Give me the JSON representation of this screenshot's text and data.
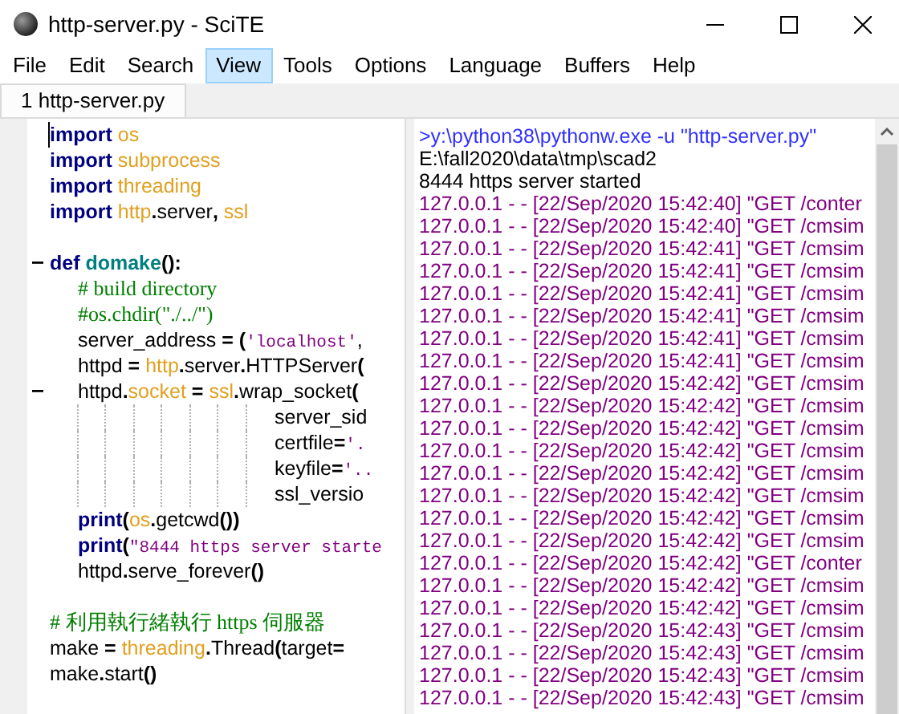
{
  "window": {
    "title": "http-server.py - SciTE"
  },
  "menu": [
    {
      "label": "File",
      "selected": false
    },
    {
      "label": "Edit",
      "selected": false
    },
    {
      "label": "Search",
      "selected": false
    },
    {
      "label": "View",
      "selected": true
    },
    {
      "label": "Tools",
      "selected": false
    },
    {
      "label": "Options",
      "selected": false
    },
    {
      "label": "Language",
      "selected": false
    },
    {
      "label": "Buffers",
      "selected": false
    },
    {
      "label": "Help",
      "selected": false
    }
  ],
  "tabs": [
    {
      "label": "1 http-server.py",
      "selected": true
    }
  ],
  "editor": {
    "lines": [
      {
        "collapsible": false,
        "segments": [
          {
            "kind": "keyword",
            "text": "import"
          },
          {
            "kind": "module",
            "text": " os"
          }
        ]
      },
      {
        "collapsible": false,
        "segments": [
          {
            "kind": "keyword",
            "text": "import"
          },
          {
            "kind": "module",
            "text": " subprocess"
          }
        ]
      },
      {
        "collapsible": false,
        "segments": [
          {
            "kind": "keyword",
            "text": "import"
          },
          {
            "kind": "module",
            "text": " threading"
          }
        ]
      },
      {
        "collapsible": false,
        "segments": [
          {
            "kind": "keyword",
            "text": "import"
          },
          {
            "kind": "module",
            "text": " http"
          },
          {
            "kind": "operator",
            "text": "."
          },
          {
            "kind": "plain",
            "text": "server"
          },
          {
            "kind": "operator",
            "text": ","
          },
          {
            "kind": "module",
            "text": " ssl"
          }
        ]
      },
      {
        "collapsible": false
      },
      {
        "collapsible": true,
        "segments": [
          {
            "kind": "keyword",
            "text": "def"
          },
          {
            "kind": "defname",
            "text": " domake"
          },
          {
            "kind": "operator",
            "text": "():"
          }
        ],
        "children": [
          {
            "collapsible": false,
            "segments": [
              {
                "kind": "comment",
                "text": "# build directory"
              }
            ]
          },
          {
            "collapsible": false,
            "segments": [
              {
                "kind": "comment",
                "text": "#os.chdir(\"./../\")"
              }
            ]
          },
          {
            "collapsible": false,
            "segments": [
              {
                "kind": "plain",
                "text": "server_address "
              },
              {
                "kind": "operator",
                "text": "="
              },
              {
                "kind": "operator",
                "text": " ("
              },
              {
                "kind": "string",
                "text": "'localhost'"
              },
              {
                "kind": "plain",
                "text": ","
              }
            ]
          },
          {
            "collapsible": false,
            "segments": [
              {
                "kind": "plain",
                "text": "httpd "
              },
              {
                "kind": "operator",
                "text": "="
              },
              {
                "kind": "module",
                "text": " http"
              },
              {
                "kind": "operator",
                "text": "."
              },
              {
                "kind": "plain",
                "text": "server"
              },
              {
                "kind": "operator",
                "text": "."
              },
              {
                "kind": "plain",
                "text": "HTTPServer"
              },
              {
                "kind": "operator",
                "text": "("
              }
            ]
          },
          {
            "collapsible": true,
            "segments": [
              {
                "kind": "plain",
                "text": "httpd"
              },
              {
                "kind": "operator",
                "text": "."
              },
              {
                "kind": "module",
                "text": "socket"
              },
              {
                "kind": "operator",
                "text": " ="
              },
              {
                "kind": "module",
                "text": " ssl"
              },
              {
                "kind": "operator",
                "text": "."
              },
              {
                "kind": "plain",
                "text": "wrap_socket"
              },
              {
                "kind": "operator",
                "text": "("
              }
            ],
            "children": [
              {
                "kind": "continuation",
                "collapsible": false,
                "segments": [
                  {
                    "kind": "plain",
                    "text": "server_sid"
                  }
                ]
              },
              {
                "kind": "continuation",
                "collapsible": false,
                "segments": [
                  {
                    "kind": "plain",
                    "text": "certfile"
                  },
                  {
                    "kind": "operator",
                    "text": "="
                  },
                  {
                    "kind": "string",
                    "text": "'."
                  }
                ]
              },
              {
                "kind": "continuation",
                "collapsible": false,
                "segments": [
                  {
                    "kind": "plain",
                    "text": "keyfile"
                  },
                  {
                    "kind": "operator",
                    "text": "="
                  },
                  {
                    "kind": "string",
                    "text": "'.."
                  }
                ]
              },
              {
                "kind": "continuation",
                "collapsible": false,
                "segments": [
                  {
                    "kind": "plain",
                    "text": "ssl_versio"
                  }
                ]
              }
            ]
          },
          {
            "collapsible": false,
            "segments": [
              {
                "kind": "keyword",
                "text": "print"
              },
              {
                "kind": "operator",
                "text": "("
              },
              {
                "kind": "module",
                "text": "os"
              },
              {
                "kind": "operator",
                "text": "."
              },
              {
                "kind": "plain",
                "text": "getcwd"
              },
              {
                "kind": "operator",
                "text": "())"
              }
            ]
          },
          {
            "collapsible": false,
            "segments": [
              {
                "kind": "keyword",
                "text": "print"
              },
              {
                "kind": "operator",
                "text": "("
              },
              {
                "kind": "string",
                "text": "\"8444 https server starte"
              }
            ]
          },
          {
            "collapsible": false,
            "segments": [
              {
                "kind": "plain",
                "text": "httpd"
              },
              {
                "kind": "operator",
                "text": "."
              },
              {
                "kind": "plain",
                "text": "serve_forever"
              },
              {
                "kind": "operator",
                "text": "()"
              }
            ]
          }
        ]
      },
      {
        "collapsible": false
      },
      {
        "collapsible": false,
        "segments": [
          {
            "kind": "comment",
            "text": "# 利用執行緒執行 https 伺服器"
          }
        ]
      },
      {
        "collapsible": false,
        "segments": [
          {
            "kind": "plain",
            "text": "make "
          },
          {
            "kind": "operator",
            "text": "="
          },
          {
            "kind": "module",
            "text": " threading"
          },
          {
            "kind": "operator",
            "text": "."
          },
          {
            "kind": "plain",
            "text": "Thread"
          },
          {
            "kind": "operator",
            "text": "("
          },
          {
            "kind": "plain",
            "text": "target"
          },
          {
            "kind": "operator",
            "text": "="
          }
        ]
      },
      {
        "collapsible": false,
        "segments": [
          {
            "kind": "plain",
            "text": "make"
          },
          {
            "kind": "operator",
            "text": "."
          },
          {
            "kind": "plain",
            "text": "start"
          },
          {
            "kind": "operator",
            "text": "()"
          }
        ]
      }
    ]
  },
  "output": {
    "lines": [
      {
        "kind": "command",
        "text": ">y:\\python38\\pythonw.exe -u \"http-server.py\""
      },
      {
        "kind": "plain",
        "text": "E:\\fall2020\\data\\tmp\\scad2"
      },
      {
        "kind": "plain",
        "text": "8444 https server started"
      },
      {
        "kind": "log",
        "text": "127.0.0.1 - - [22/Sep/2020 15:42:40] \"GET /conter"
      },
      {
        "kind": "log",
        "text": "127.0.0.1 - - [22/Sep/2020 15:42:40] \"GET /cmsim"
      },
      {
        "kind": "log",
        "text": "127.0.0.1 - - [22/Sep/2020 15:42:41] \"GET /cmsim"
      },
      {
        "kind": "log",
        "text": "127.0.0.1 - - [22/Sep/2020 15:42:41] \"GET /cmsim"
      },
      {
        "kind": "log",
        "text": "127.0.0.1 - - [22/Sep/2020 15:42:41] \"GET /cmsim"
      },
      {
        "kind": "log",
        "text": "127.0.0.1 - - [22/Sep/2020 15:42:41] \"GET /cmsim"
      },
      {
        "kind": "log",
        "text": "127.0.0.1 - - [22/Sep/2020 15:42:41] \"GET /cmsim"
      },
      {
        "kind": "log",
        "text": "127.0.0.1 - - [22/Sep/2020 15:42:41] \"GET /cmsim"
      },
      {
        "kind": "log",
        "text": "127.0.0.1 - - [22/Sep/2020 15:42:42] \"GET /cmsim"
      },
      {
        "kind": "log",
        "text": "127.0.0.1 - - [22/Sep/2020 15:42:42] \"GET /cmsim"
      },
      {
        "kind": "log",
        "text": "127.0.0.1 - - [22/Sep/2020 15:42:42] \"GET /cmsim"
      },
      {
        "kind": "log",
        "text": "127.0.0.1 - - [22/Sep/2020 15:42:42] \"GET /cmsim"
      },
      {
        "kind": "log",
        "text": "127.0.0.1 - - [22/Sep/2020 15:42:42] \"GET /cmsim"
      },
      {
        "kind": "log",
        "text": "127.0.0.1 - - [22/Sep/2020 15:42:42] \"GET /cmsim"
      },
      {
        "kind": "log",
        "text": "127.0.0.1 - - [22/Sep/2020 15:42:42] \"GET /cmsim"
      },
      {
        "kind": "log",
        "text": "127.0.0.1 - - [22/Sep/2020 15:42:42] \"GET /cmsim"
      },
      {
        "kind": "log",
        "text": "127.0.0.1 - - [22/Sep/2020 15:42:42] \"GET /conter"
      },
      {
        "kind": "log",
        "text": "127.0.0.1 - - [22/Sep/2020 15:42:42] \"GET /cmsim"
      },
      {
        "kind": "log",
        "text": "127.0.0.1 - - [22/Sep/2020 15:42:42] \"GET /cmsim"
      },
      {
        "kind": "log",
        "text": "127.0.0.1 - - [22/Sep/2020 15:42:43] \"GET /cmsim"
      },
      {
        "kind": "log",
        "text": "127.0.0.1 - - [22/Sep/2020 15:42:43] \"GET /cmsim"
      },
      {
        "kind": "log",
        "text": "127.0.0.1 - - [22/Sep/2020 15:42:43] \"GET /cmsim"
      },
      {
        "kind": "log",
        "text": "127.0.0.1 - - [22/Sep/2020 15:42:43] \"GET /cmsim"
      }
    ]
  }
}
